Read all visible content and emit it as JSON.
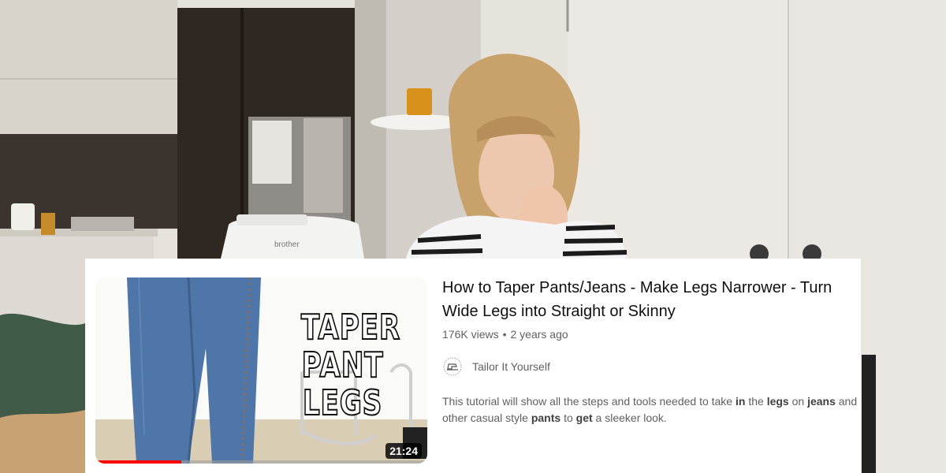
{
  "video": {
    "title": "How to Taper Pants/Jeans - Make Legs Narrower - Turn Wide Legs into Straight or Skinny",
    "views": "176K views",
    "separator": "•",
    "age": "2 years ago",
    "duration": "21:24",
    "watch_progress_percent": 26,
    "thumbnail_text": [
      "TAPER",
      "PANT",
      "LEGS"
    ],
    "progress_color": "#ff0000"
  },
  "channel": {
    "name": "Tailor It Yourself",
    "avatar_icon": "sewing-machine-logo-icon"
  },
  "description": {
    "parts": [
      {
        "text": "This tutorial will show all the steps and tools needed to take ",
        "bold": false
      },
      {
        "text": "in",
        "bold": true
      },
      {
        "text": " the ",
        "bold": false
      },
      {
        "text": "legs",
        "bold": true
      },
      {
        "text": " on ",
        "bold": false
      },
      {
        "text": "jeans",
        "bold": true
      },
      {
        "text": " and other casual style ",
        "bold": false
      },
      {
        "text": "pants",
        "bold": true
      },
      {
        "text": " to ",
        "bold": false
      },
      {
        "text": "get",
        "bold": true
      },
      {
        "text": " a sleeker look.",
        "bold": false
      }
    ]
  },
  "background": {
    "sewing_machine_brand": "brother"
  }
}
